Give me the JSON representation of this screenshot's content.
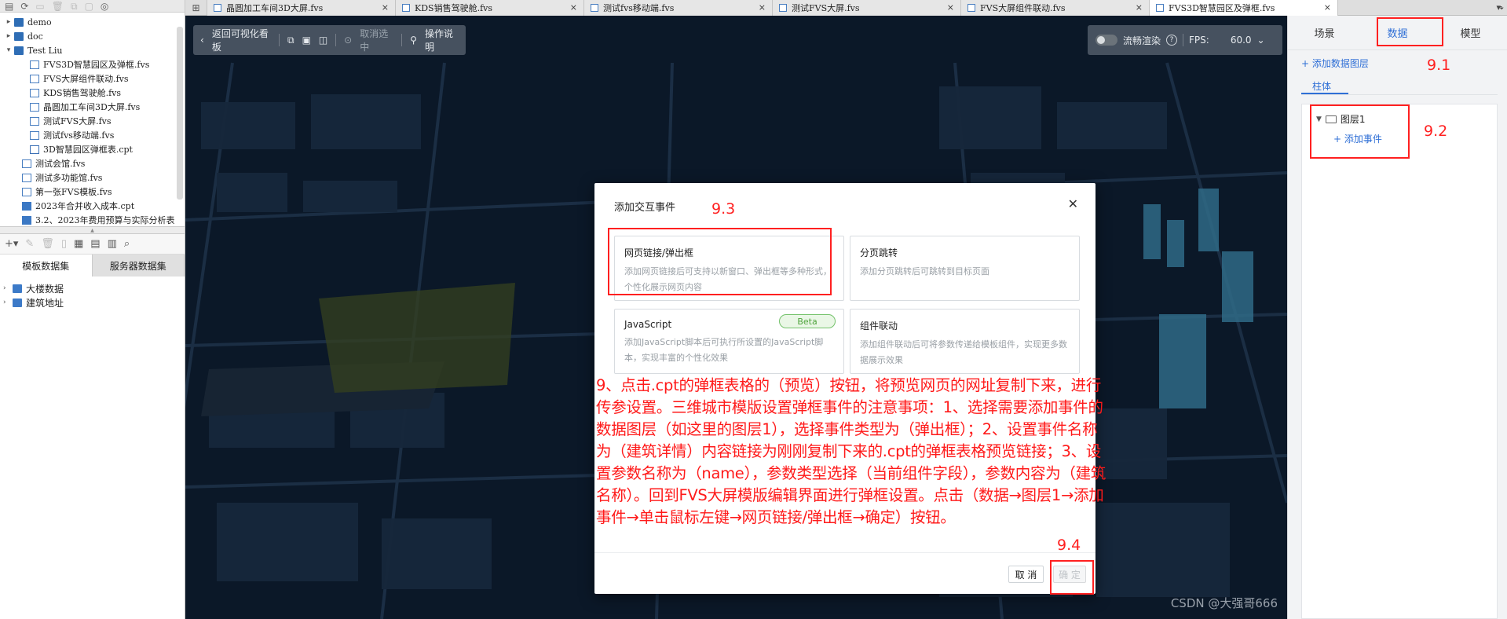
{
  "left_panel": {
    "tree": [
      {
        "label": "demo",
        "type": "folder",
        "indent": 0,
        "expanded": false
      },
      {
        "label": "doc",
        "type": "folder",
        "indent": 0,
        "expanded": false
      },
      {
        "label": "Test Liu",
        "type": "folder",
        "indent": 0,
        "expanded": true
      },
      {
        "label": "FVS3D智慧园区及弹框.fvs",
        "type": "fvs",
        "indent": 2
      },
      {
        "label": "FVS大屏组件联动.fvs",
        "type": "fvs",
        "indent": 2
      },
      {
        "label": "KDS销售驾驶舱.fvs",
        "type": "fvs",
        "indent": 2
      },
      {
        "label": "晶圆加工车间3D大屏.fvs",
        "type": "fvs",
        "indent": 2
      },
      {
        "label": "测试FVS大屏.fvs",
        "type": "fvs",
        "indent": 2
      },
      {
        "label": "测试fvs移动端.fvs",
        "type": "fvs",
        "indent": 2
      },
      {
        "label": "3D智慧园区弹框表.cpt",
        "type": "cpt",
        "indent": 2
      },
      {
        "label": "测试会馆.fvs",
        "type": "fvs",
        "indent": 1
      },
      {
        "label": "测试多功能馆.fvs",
        "type": "fvs",
        "indent": 1
      },
      {
        "label": "第一张FVS模板.fvs",
        "type": "fvs",
        "indent": 1
      },
      {
        "label": "2023年合并收入成本.cpt",
        "type": "cpt2",
        "indent": 1
      },
      {
        "label": "3.2、2023年费用预算与实际分析表",
        "type": "cpt2",
        "indent": 1
      }
    ],
    "tabs": [
      "模板数据集",
      "服务器数据集"
    ],
    "datasets": [
      "大楼数据",
      "建筑地址"
    ]
  },
  "tabbar": {
    "tabs": [
      {
        "label": "晶圆加工车间3D大屏.fvs",
        "active": false
      },
      {
        "label": "KDS销售驾驶舱.fvs",
        "active": false
      },
      {
        "label": "测试fvs移动端.fvs",
        "active": false
      },
      {
        "label": "测试FVS大屏.fvs",
        "active": false
      },
      {
        "label": "FVS大屏组件联动.fvs",
        "active": false
      },
      {
        "label": "FVS3D智慧园区及弹框.fvs",
        "active": true
      }
    ],
    "close_glyph": "×"
  },
  "canvas_toolbar": {
    "back_label": "返回可视化看板",
    "cancel_select_label": "取消选中",
    "help_label": "操作说明",
    "render_label": "流畅渲染",
    "fps_label": "FPS:",
    "fps_value": "60.0"
  },
  "modal": {
    "title": "添加交互事件",
    "options": [
      {
        "title": "网页链接/弹出框",
        "desc": "添加网页链接后可支持以新窗口、弹出框等多种形式，个性化展示网页内容"
      },
      {
        "title": "分页跳转",
        "desc": "添加分页跳转后可跳转到目标页面"
      },
      {
        "title": "JavaScript",
        "desc": "添加JavaScript脚本后可执行所设置的JavaScript脚本，实现丰富的个性化效果",
        "badge": "Beta"
      },
      {
        "title": "组件联动",
        "desc": "添加组件联动后可将参数传递给模板组件，实现更多数据展示效果"
      }
    ],
    "cancel_label": "取 消",
    "ok_label": "确 定"
  },
  "annotations": {
    "labels": [
      "9.1",
      "9.2",
      "9.3",
      "9.4"
    ],
    "note": "9、点击.cpt的弹框表格的（预览）按钮，将预览网页的网址复制下来，进行传参设置。三维城市模版设置弹框事件的注意事项：1、选择需要添加事件的数据图层（如这里的图层1），选择事件类型为（弹出框）；2、设置事件名称为（建筑详情）内容链接为刚刚复制下来的.cpt的弹框表格预览链接；3、设置参数名称为（name），参数类型选择（当前组件字段），参数内容为（建筑名称）。回到FVS大屏模版编辑界面进行弹框设置。点击（数据→图层1→添加事件→单击鼠标左键→网页链接/弹出框→确定）按钮。"
  },
  "right_panel": {
    "tabs": [
      {
        "label": "场景",
        "active": false
      },
      {
        "label": "数据",
        "active": true
      },
      {
        "label": "模型",
        "active": false
      }
    ],
    "add_layer_label": "+ 添加数据图层",
    "sub_tab": "柱体",
    "layer_name": "图层1",
    "add_event_label": "+ 添加事件"
  },
  "watermark": "CSDN @大强哥666"
}
